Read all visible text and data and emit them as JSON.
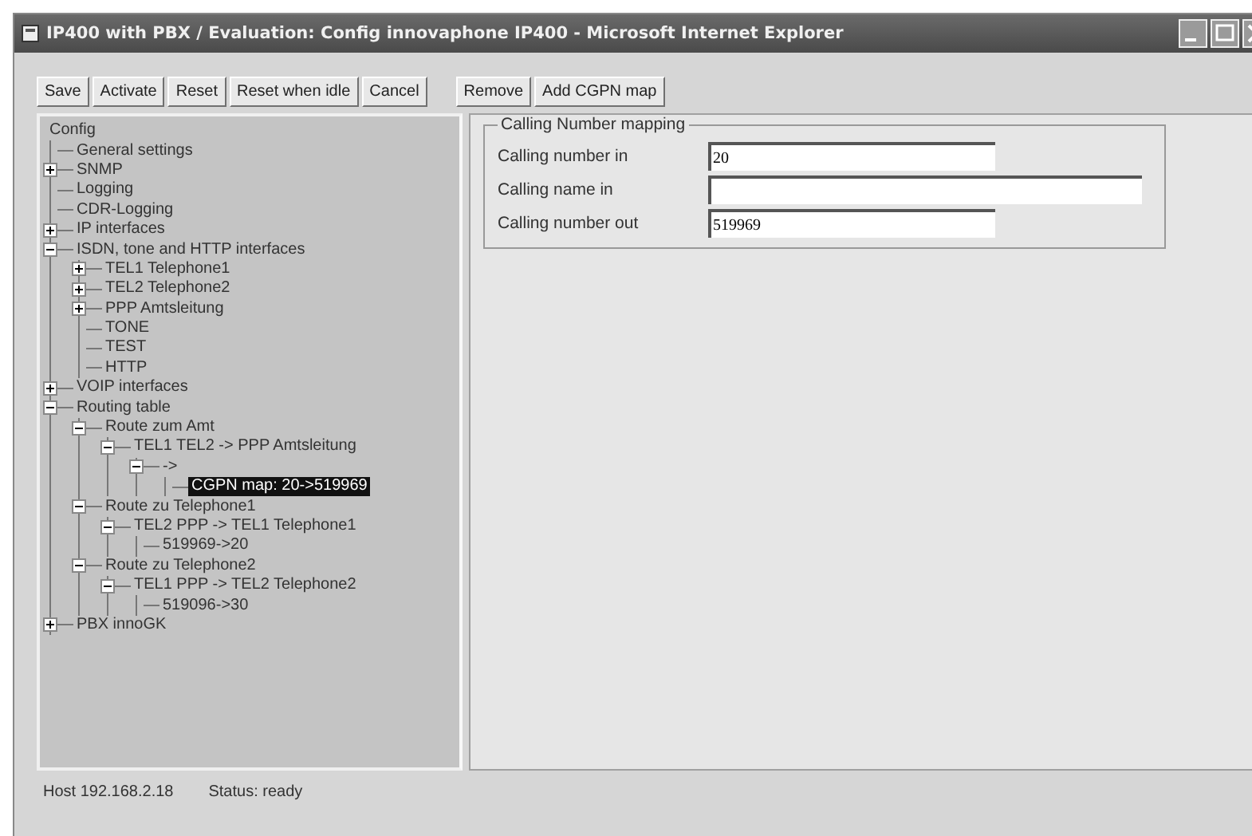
{
  "window": {
    "title": "IP400 with  PBX / Evaluation: Config innovaphone IP400 - Microsoft Internet Explorer"
  },
  "toolbar": {
    "groups": [
      [
        "Save",
        "Activate",
        "Reset",
        "Reset when idle",
        "Cancel"
      ],
      [
        "Remove",
        "Add CGPN map"
      ]
    ]
  },
  "tree": {
    "label": "Config",
    "children": [
      {
        "label": "General settings"
      },
      {
        "label": "SNMP",
        "expanded": false
      },
      {
        "label": "Logging"
      },
      {
        "label": "CDR-Logging"
      },
      {
        "label": "IP interfaces",
        "expanded": false
      },
      {
        "label": "ISDN, tone and HTTP interfaces",
        "expanded": true,
        "children": [
          {
            "label": "TEL1 Telephone1",
            "expanded": false
          },
          {
            "label": "TEL2 Telephone2",
            "expanded": false
          },
          {
            "label": "PPP Amtsleitung",
            "expanded": false
          },
          {
            "label": "TONE"
          },
          {
            "label": "TEST"
          },
          {
            "label": "HTTP"
          }
        ]
      },
      {
        "label": "VOIP interfaces",
        "expanded": false
      },
      {
        "label": "Routing table",
        "expanded": true,
        "children": [
          {
            "label": "Route zum Amt",
            "expanded": true,
            "children": [
              {
                "label": "TEL1  TEL2 -> PPP Amtsleitung",
                "expanded": true,
                "children": [
                  {
                    "label": "->",
                    "expanded": true,
                    "children": [
                      {
                        "label": "CGPN map: 20->519969",
                        "selected": true
                      }
                    ]
                  }
                ]
              }
            ]
          },
          {
            "label": "Route zu Telephone1",
            "expanded": true,
            "children": [
              {
                "label": "TEL2 PPP -> TEL1 Telephone1",
                "expanded": true,
                "children": [
                  {
                    "label": "519969->20",
                    "selected": false
                  }
                ]
              }
            ]
          },
          {
            "label": "Route zu Telephone2",
            "expanded": true,
            "children": [
              {
                "label": "TEL1  PPP -> TEL2 Telephone2",
                "expanded": true,
                "children": [
                  {
                    "label": "519096->30",
                    "selected": false
                  }
                ]
              }
            ]
          }
        ]
      },
      {
        "label": "PBX innoGK",
        "expanded": false
      }
    ]
  },
  "form": {
    "legend": "Calling Number mapping",
    "fields": [
      {
        "label": "Calling number in",
        "value": "20",
        "wide": false
      },
      {
        "label": "Calling name in",
        "wide": true
      },
      {
        "label": "Calling number out",
        "value": "519969",
        "wide": false
      }
    ]
  },
  "status_bar": {
    "host": "Host 192.168.2.18",
    "status": "Status: ready"
  }
}
